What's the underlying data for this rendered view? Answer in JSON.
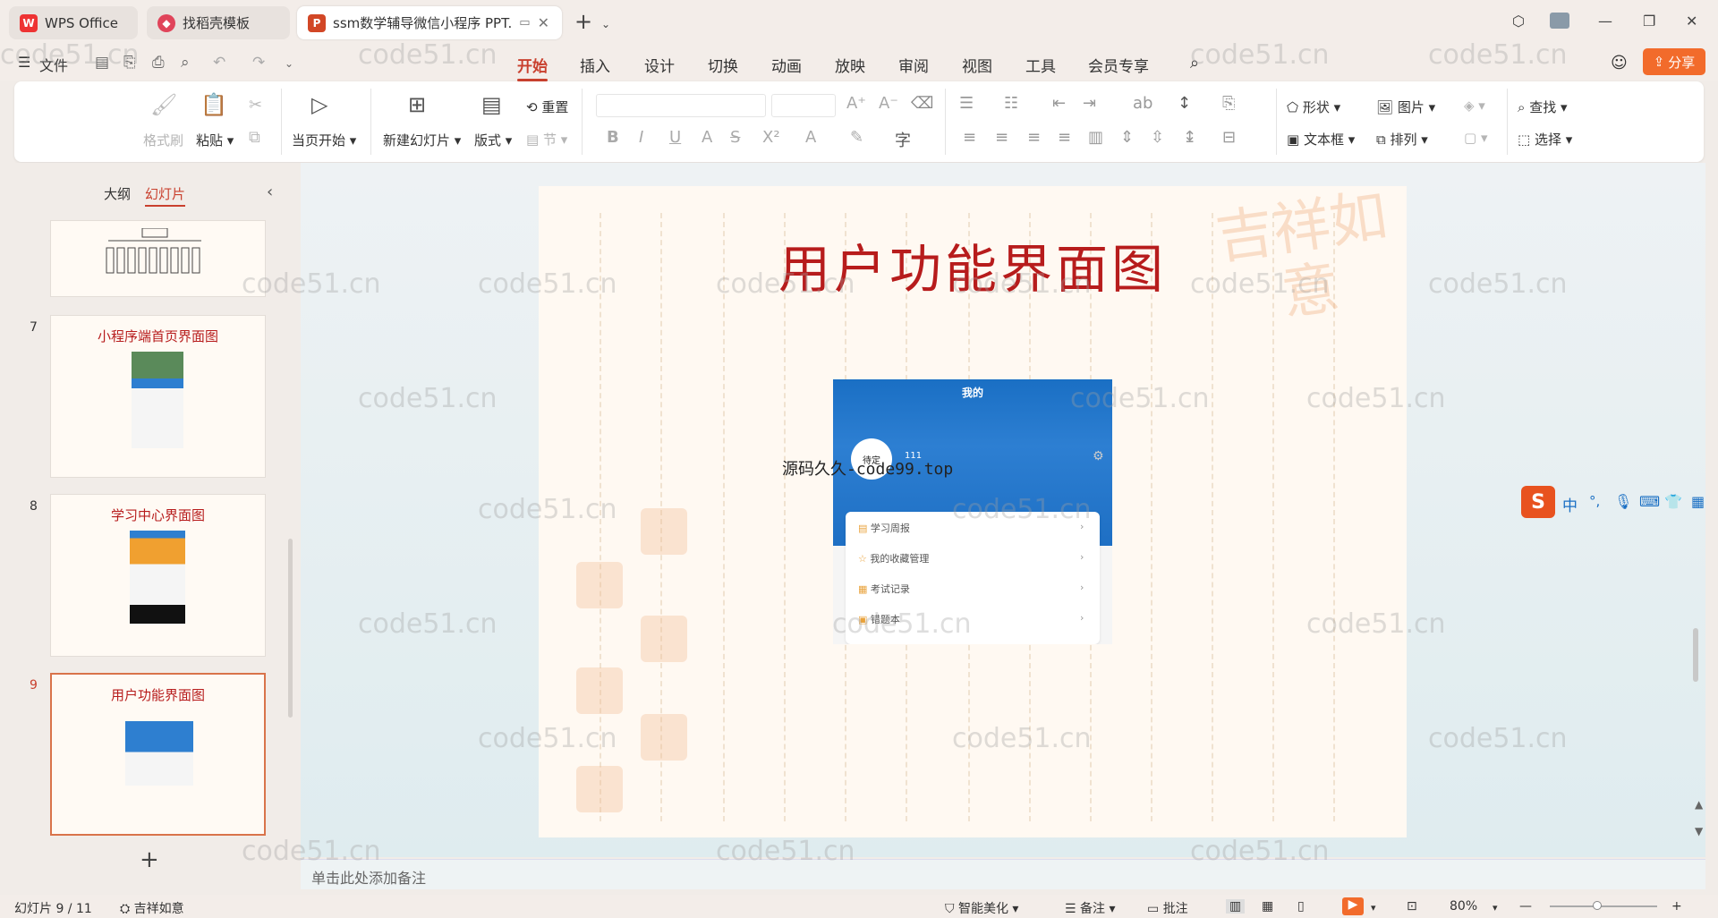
{
  "tabs": [
    {
      "label": "WPS Office",
      "icon": "wps-logo-icon"
    },
    {
      "label": "找稻壳模板",
      "icon": "docer-logo-icon"
    },
    {
      "label": "ssm数学辅导微信小程序 PPT.",
      "icon": "ppt-logo-icon"
    }
  ],
  "menu": {
    "file": "文件",
    "items": [
      "开始",
      "插入",
      "设计",
      "切换",
      "动画",
      "放映",
      "审阅",
      "视图",
      "工具",
      "会员专享"
    ],
    "active": "开始",
    "share": "分享"
  },
  "ribbon": {
    "format_painter": "格式刷",
    "paste": "粘贴",
    "from_current": "当页开始",
    "new_slide": "新建幻灯片",
    "layout": "版式",
    "reset": "重置",
    "section": "节",
    "shape": "形状",
    "picture": "图片",
    "find": "查找",
    "textbox": "文本框",
    "arrange": "排列",
    "select": "选择"
  },
  "panel": {
    "tab_outline": "大纲",
    "tab_slides": "幻灯片",
    "slides": [
      {
        "num": "7",
        "title": "小程序端首页界面图"
      },
      {
        "num": "8",
        "title": "学习中心界面图"
      },
      {
        "num": "9",
        "title": "用户功能界面图"
      }
    ]
  },
  "slide": {
    "title": "用户功能界面图",
    "seal_text": "吉祥如意",
    "overlay_text": "源码久久-code99.top",
    "phone": {
      "header": "我的",
      "avatar_text": "待定",
      "user_id": "111",
      "menu": [
        "学习周报",
        "我的收藏管理",
        "考试记录",
        "错题本"
      ]
    }
  },
  "notes_placeholder": "单击此处添加备注",
  "status": {
    "slide_counter": "幻灯片 9 / 11",
    "theme": "吉祥如意",
    "beautify": "智能美化",
    "notes": "备注",
    "comments": "批注",
    "zoom": "80%"
  },
  "watermark": "code51.cn",
  "colors": {
    "accent": "#c9402e",
    "share_btn": "#f26b2b",
    "title_red": "#b71c1c"
  }
}
